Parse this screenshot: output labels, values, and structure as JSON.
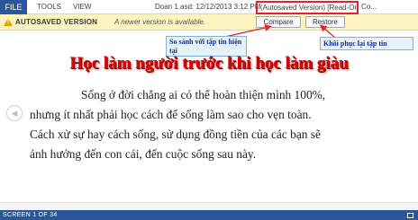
{
  "ribbon": {
    "file_tab": "FILE",
    "tabs": [
      "TOOLS",
      "VIEW"
    ],
    "doc_title": "Doan 1.asd: 12/12/2013 3:12 PM",
    "title_highlight": "(Autosaved Version) [Read-Only]",
    "title_tail": "Co..."
  },
  "message_bar": {
    "icon": "warning-icon",
    "title": "AUTOSAVED VERSION",
    "text": "A newer version is available.",
    "compare_label": "Compare",
    "restore_label": "Restore"
  },
  "callouts": {
    "compare_note": "So sánh với tập tin hiện tại",
    "restore_note": "Khôi phục lại tập tin"
  },
  "document": {
    "heading": "Học làm người trước khi học làm giàu",
    "lines": [
      "Sống ở đời chẳng ai có thể hoàn thiện mình 100%,",
      "nhưng ít nhất phải học cách để sống làm sao cho vẹn toàn.",
      "Cách xử sự hay cách sống, sử dụng đồng tiền của các bạn sẽ",
      "ảnh hưởng đến con cái, đến cuộc sống sau này."
    ]
  },
  "status_bar": {
    "section_text": "SCREEN 1 OF 34"
  },
  "colors": {
    "accent": "#2b579a",
    "highlight_border": "#e8202a",
    "message_bar": "#fdf4bf",
    "heading": "#e60000",
    "callout_text": "#14289f"
  }
}
